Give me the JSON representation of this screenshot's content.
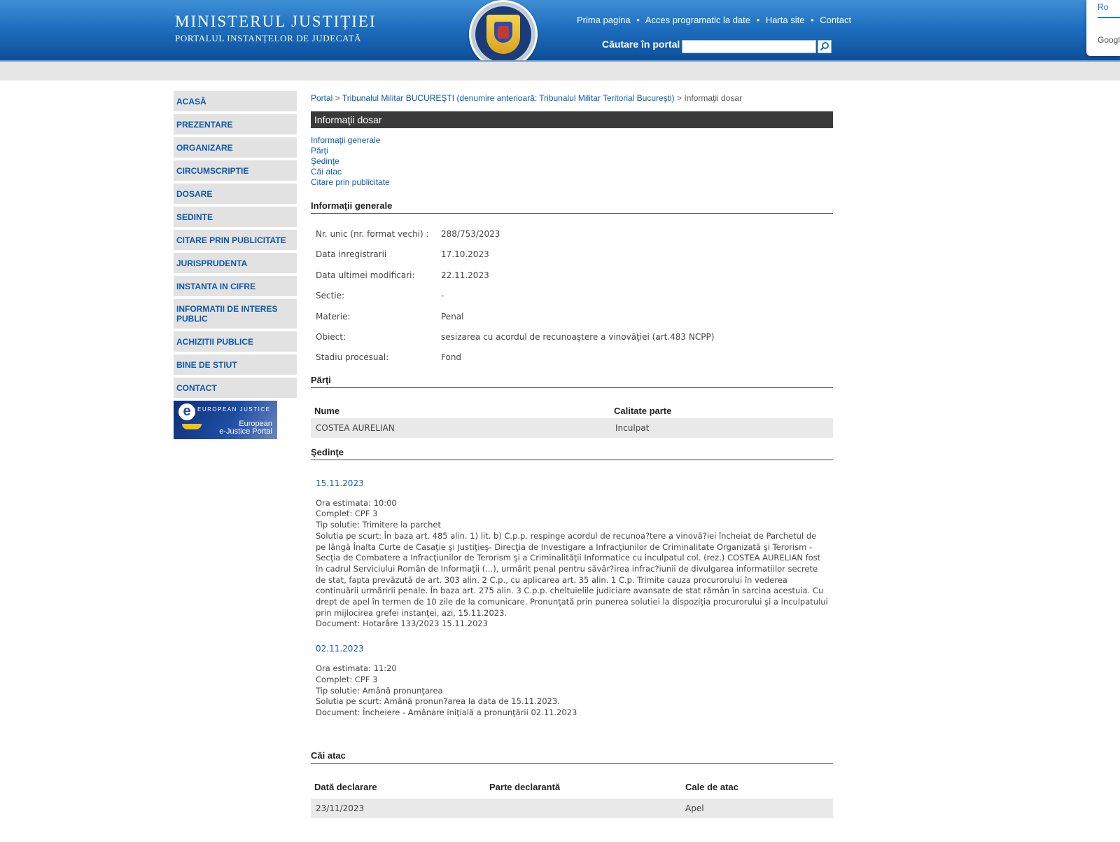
{
  "header": {
    "title": "MINISTERUL JUSTIȚIEI",
    "subtitle": "PORTALUL INSTANȚELOR DE JUDECATĂ",
    "nav": [
      "Prima pagina",
      "Acces programatic la date",
      "Harta site",
      "Contact"
    ],
    "nav_sep": "•",
    "search_label": "Căutare în portal",
    "search_value": "",
    "google_top": "Ro",
    "google_text": "Googl"
  },
  "sidebar": {
    "items": [
      "ACASĂ",
      "PREZENTARE",
      "ORGANIZARE",
      "CIRCUMSCRIPTIE",
      "DOSARE",
      "SEDINTE",
      "CITARE PRIN PUBLICITATE",
      "JURISPRUDENTA",
      "INSTANTA IN CIFRE",
      "INFORMATII DE INTERES PUBLIC",
      "ACHIZITII PUBLICE",
      "BINE DE STIUT",
      "CONTACT"
    ],
    "banner_brand": "EUROPEAN JUSTICE",
    "banner_caption_1": "European",
    "banner_caption_2": "e-Justice Portal"
  },
  "breadcrumb": {
    "portal": "Portal",
    "sep": ">",
    "court": "Tribunalul Militar BUCUREŞTI (denumire anterioară: Tribunalul Militar Teritorial Bucureşti)",
    "current": "Informaţii dosar"
  },
  "page_title": "Informaţii dosar",
  "anchors": [
    "Informaţii generale",
    "Părţi",
    "Şedinţe",
    "Căi atac",
    "Citare prin publicitate"
  ],
  "general": {
    "heading": "Informaţii generale",
    "rows": [
      {
        "k": "Nr. unic (nr. format vechi) :",
        "v": "288/753/2023"
      },
      {
        "k": "Data inregistrarii",
        "v": "17.10.2023"
      },
      {
        "k": "Data ultimei modificari:",
        "v": "22.11.2023"
      },
      {
        "k": "Sectie:",
        "v": "-"
      },
      {
        "k": "Materie:",
        "v": "Penal"
      },
      {
        "k": "Obiect:",
        "v": "sesizarea cu acordul de recunoaştere a vinovăţiei (art.483 NCPP)"
      },
      {
        "k": "Stadiu procesual:",
        "v": "Fond"
      }
    ]
  },
  "parti": {
    "heading": "Părţi",
    "col_nume": "Nume",
    "col_calitate": "Calitate parte",
    "rows": [
      {
        "nume": "COSTEA AURELIAN",
        "calitate": "Inculpat"
      }
    ]
  },
  "sedinte": {
    "heading": "Şedinţe",
    "sessions": [
      {
        "date": "15.11.2023",
        "lines": [
          "Ora estimata: 10:00",
          "Complet: CPF 3",
          "Tip solutie: Trimitere la parchet",
          "Solutia pe scurt: În baza art. 485 alin. 1) lit. b) C.p.p. respinge acordul de recunoa?tere a vinovă?iei încheiat de Parchetul de",
          "pe lângă Înalta Curte de Casaţie şi Justiţieş- Direcţia de Investigare a Infracţiunilor de Criminalitate Organizată şi Terorism -",
          "Secţia de Combatere a Infracţiunilor de Terorism şi a Criminalităţii Informatice cu inculpatul col. (rez.) COSTEA AURELIAN fost",
          "în cadrul Serviciului Român de Informaţii (...), urmărit penal pentru săvâr?irea infrac?iunii de divulgarea informatiilor secrete",
          "de stat, fapta prevăzută de art. 303 alin. 2 C.p., cu aplicarea art. 35 alin. 1 C.p. Trimite cauza procurorului în vederea",
          "continuării urmăririi penale. În baza art. 275 alin. 3 C.p.p. cheltuielile judiciare avansate de stat rămân în sarcina acestuia. Cu",
          "drept de apel în termen de 10 zile de la comunicare. Pronunţată prin punerea solutiei la dispoziţia procurorului şi a inculpatului",
          "prin mijlocirea grefei instanţei, azi, 15.11.2023.",
          "Document: Hotarâre  133/2023  15.11.2023"
        ]
      },
      {
        "date": "02.11.2023",
        "lines": [
          "Ora estimata: 11:20",
          "Complet: CPF 3",
          "Tip solutie: Amână pronunţarea",
          "Solutia pe scurt: Amână pronun?area la data de 15.11.2023.",
          "Document: Încheiere - Amânare iniţială a pronunţării    02.11.2023"
        ]
      }
    ]
  },
  "cai_atac": {
    "heading": "Căi atac",
    "col_data": "Dată declarare",
    "col_parte": "Parte declarantă",
    "col_cale": "Cale de atac",
    "rows": [
      {
        "data": "23/11/2023",
        "parte": "",
        "cale": "Apel"
      }
    ]
  }
}
